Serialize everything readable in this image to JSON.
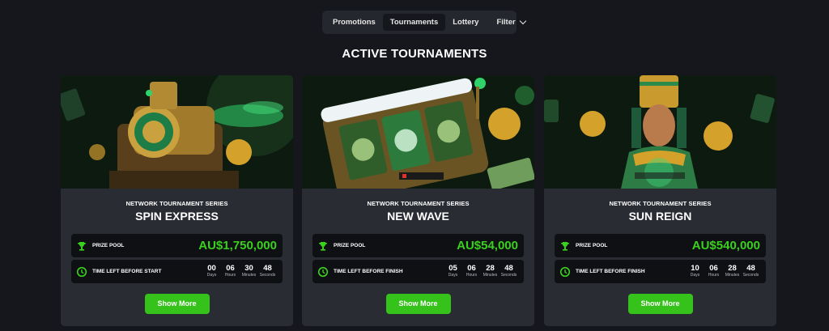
{
  "nav": {
    "tabs": [
      "Promotions",
      "Tournaments",
      "Lottery"
    ],
    "active_tab": "Tournaments",
    "filter_label": "Filter"
  },
  "section_title": "ACTIVE TOURNAMENTS",
  "colors": {
    "accent": "#35c21a",
    "prize": "#39d11d",
    "card": "#2a2c34",
    "bg": "#16171d"
  },
  "cards": [
    {
      "series": "NETWORK TOURNAMENT SERIES",
      "name": "SPIN EXPRESS",
      "prize_label": "PRIZE POOL",
      "prize_value": "AU$1,750,000",
      "time_label": "TIME LEFT BEFORE START",
      "days": "00",
      "hours": "06",
      "minutes": "30",
      "seconds": "48",
      "button": "Show More"
    },
    {
      "series": "NETWORK TOURNAMENT SERIES",
      "name": "NEW WAVE",
      "prize_label": "PRIZE POOL",
      "prize_value": "AU$54,000",
      "time_label": "TIME LEFT BEFORE FINISH",
      "days": "05",
      "hours": "06",
      "minutes": "28",
      "seconds": "48",
      "button": "Show More"
    },
    {
      "series": "NETWORK TOURNAMENT SERIES",
      "name": "SUN REIGN",
      "prize_label": "PRIZE POOL",
      "prize_value": "AU$540,000",
      "time_label": "TIME LEFT BEFORE FINISH",
      "days": "10",
      "hours": "06",
      "minutes": "28",
      "seconds": "48",
      "button": "Show More"
    }
  ],
  "units": {
    "days": "Days",
    "hours": "Hours",
    "minutes": "Minutes",
    "seconds": "Seconds"
  }
}
